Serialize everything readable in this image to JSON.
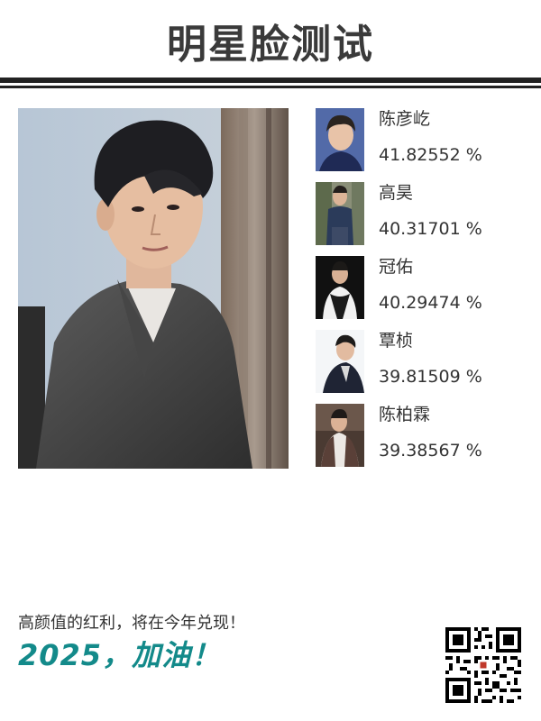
{
  "header": {
    "title": "明星脸测试"
  },
  "main_photo": {
    "icon": "portrait-photo"
  },
  "results": [
    {
      "name": "陈彦屹",
      "score": "41.82552 %",
      "icon": "celebrity-photo"
    },
    {
      "name": "高昊",
      "score": "40.31701 %",
      "icon": "celebrity-photo"
    },
    {
      "name": "冠佑",
      "score": "40.29474 %",
      "icon": "celebrity-photo"
    },
    {
      "name": "覃桢",
      "score": "39.81509 %",
      "icon": "celebrity-photo"
    },
    {
      "name": "陈柏霖",
      "score": "39.38567 %",
      "icon": "celebrity-photo"
    }
  ],
  "footer": {
    "slogan": "高颜值的红利，将在今年兑现！",
    "cheer": "2025，加油！",
    "qr_icon": "qr-code"
  },
  "colors": {
    "accent": "#138a8a",
    "text": "#333333",
    "rule": "#222222"
  }
}
